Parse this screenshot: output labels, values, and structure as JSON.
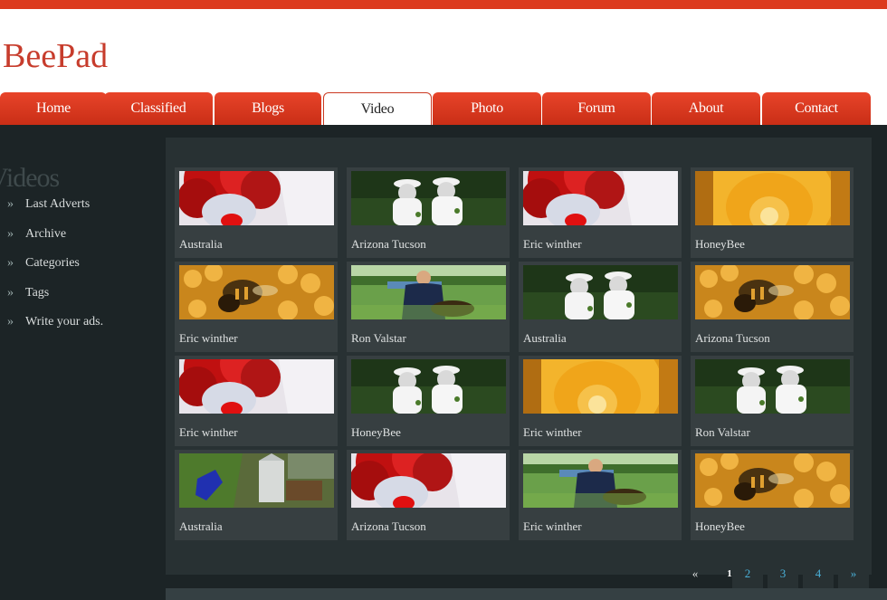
{
  "site": {
    "logo": "BeePad"
  },
  "nav": {
    "tabs": [
      {
        "label": "Home"
      },
      {
        "label": "Classified"
      },
      {
        "label": "Blogs"
      },
      {
        "label": "Video"
      },
      {
        "label": "Photo"
      },
      {
        "label": "Forum"
      },
      {
        "label": "About"
      },
      {
        "label": "Contact"
      }
    ],
    "active": "Video"
  },
  "sidebar": {
    "title": "Videos",
    "items": [
      {
        "label": "Last Adverts"
      },
      {
        "label": "Archive"
      },
      {
        "label": "Categories"
      },
      {
        "label": "Tags"
      },
      {
        "label": "Write your ads."
      }
    ]
  },
  "videos": [
    {
      "caption": "Australia",
      "thumb": "clown-icon"
    },
    {
      "caption": "Arizona Tucson",
      "thumb": "beekeepers-icon"
    },
    {
      "caption": "Eric winther",
      "thumb": "clown-icon"
    },
    {
      "caption": "HoneyBee",
      "thumb": "honeycomb-icon"
    },
    {
      "caption": "Eric winther",
      "thumb": "bee-icon"
    },
    {
      "caption": "Ron Valstar",
      "thumb": "swarm-icon"
    },
    {
      "caption": "Australia",
      "thumb": "beekeepers-icon"
    },
    {
      "caption": "Arizona Tucson",
      "thumb": "bee-icon"
    },
    {
      "caption": "Eric winther",
      "thumb": "clown-icon"
    },
    {
      "caption": "HoneyBee",
      "thumb": "beekeepers-icon"
    },
    {
      "caption": "Eric winther",
      "thumb": "honeycomb-icon"
    },
    {
      "caption": "Ron Valstar",
      "thumb": "beekeepers-icon"
    },
    {
      "caption": "Australia",
      "thumb": "smoker-icon"
    },
    {
      "caption": "Arizona Tucson",
      "thumb": "clown-icon"
    },
    {
      "caption": "Eric winther",
      "thumb": "swarm-icon"
    },
    {
      "caption": "HoneyBee",
      "thumb": "bee-icon"
    }
  ],
  "pager": {
    "prev": "«",
    "pages": [
      "1",
      "2",
      "3",
      "4"
    ],
    "current": "1",
    "next": "»"
  },
  "colors": {
    "accent": "#dc3a1e",
    "link": "#4ab0d8",
    "bg": "#1c2426"
  }
}
